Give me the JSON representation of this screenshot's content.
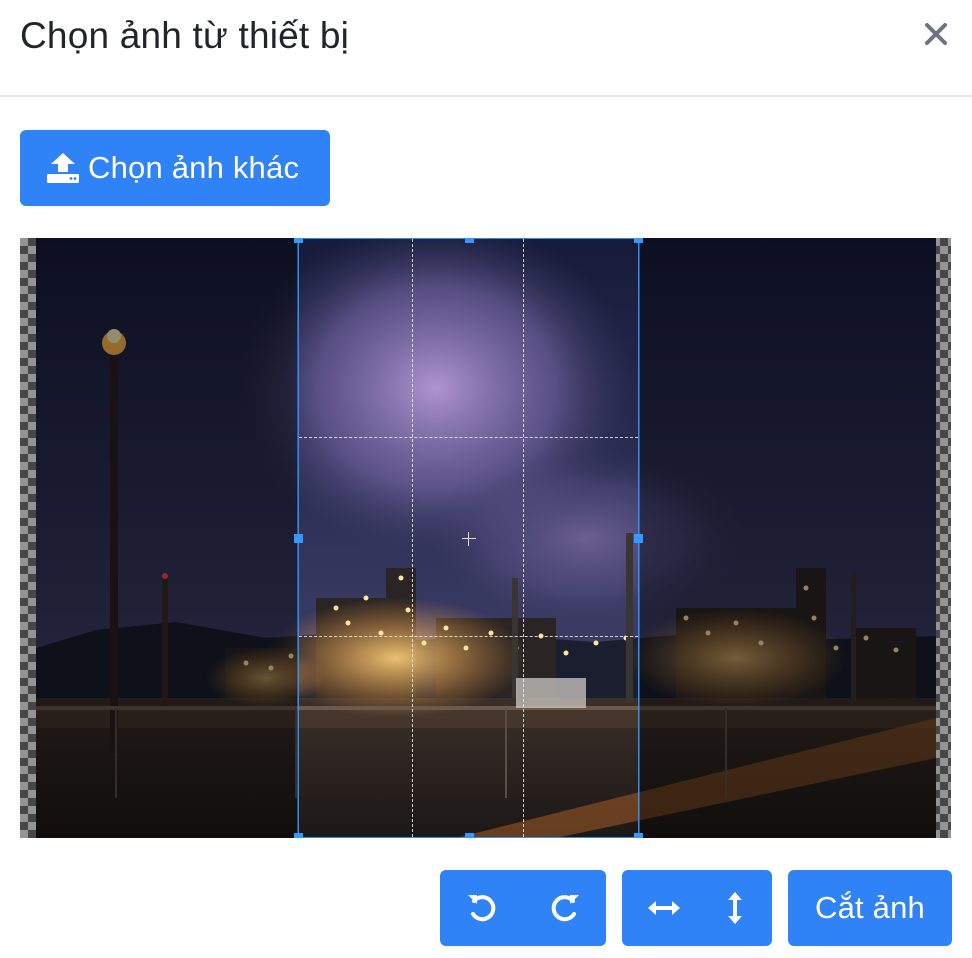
{
  "header": {
    "title": "Chọn ảnh từ thiết bị",
    "close_icon": "close-icon"
  },
  "upload": {
    "label": "Chọn ảnh khác",
    "icon": "upload-icon"
  },
  "toolbar": {
    "rotate_left_icon": "rotate-left-icon",
    "rotate_right_icon": "rotate-right-icon",
    "flip_horizontal_icon": "flip-horizontal-icon",
    "flip_vertical_icon": "flip-vertical-icon",
    "crop_label": "Cắt ảnh"
  },
  "colors": {
    "primary": "#2f83f6",
    "crop_border": "#3399ff"
  }
}
